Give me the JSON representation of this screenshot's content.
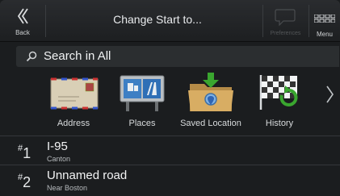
{
  "header": {
    "back_label": "Back",
    "title": "Change Start to...",
    "prefs_label": "Preferences",
    "menu_label": "Menu"
  },
  "search": {
    "label": "Search in All"
  },
  "categories": [
    {
      "label": "Address",
      "icon": "envelope-icon"
    },
    {
      "label": "Places",
      "icon": "places-sign-icon"
    },
    {
      "label": "Saved Location",
      "icon": "folder-pin-icon"
    },
    {
      "label": "History",
      "icon": "checkered-flag-icon"
    }
  ],
  "results": [
    {
      "index": "1",
      "prefix": "#",
      "name": "I-95",
      "detail": "Canton"
    },
    {
      "index": "2",
      "prefix": "#",
      "name": "Unnamed road",
      "detail": "Near Boston"
    }
  ],
  "colors": {
    "background": "#1b1d1f",
    "search_bg": "#2b2e30",
    "accent_green": "#3aa62f"
  }
}
